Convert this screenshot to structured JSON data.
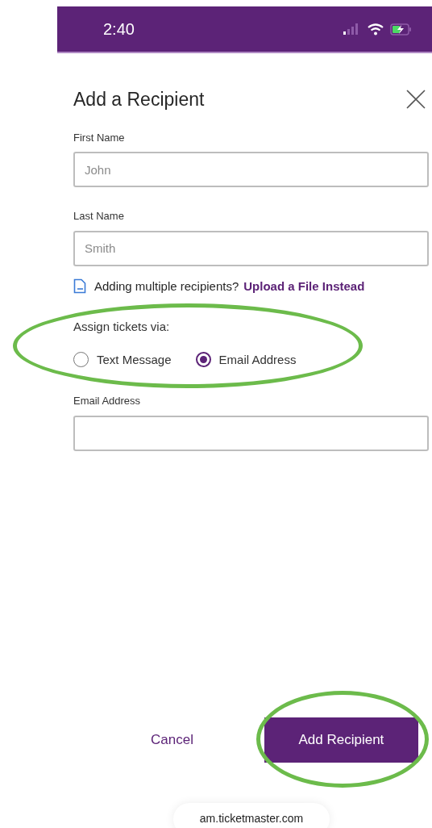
{
  "status_bar": {
    "time": "2:40"
  },
  "dialog": {
    "title": "Add a Recipient",
    "fields": [
      {
        "label": "First Name",
        "placeholder": "John"
      },
      {
        "label": "Last Name",
        "placeholder": "Smith"
      }
    ],
    "upload_hint": {
      "text": "Adding multiple recipients?",
      "link": "Upload a File Instead"
    },
    "assign": {
      "label": "Assign tickets via:",
      "circled": true,
      "options": [
        {
          "label": "Text Message",
          "selected": false
        },
        {
          "label": "Email Address",
          "selected": true
        }
      ]
    },
    "email_field": {
      "label": "Email Address"
    },
    "buttons": [
      {
        "kind": "link",
        "label": "Cancel",
        "circled": false
      },
      {
        "kind": "primary",
        "label": "Add Recipient",
        "circled": true
      }
    ]
  },
  "url": "am.ticketmaster.com"
}
